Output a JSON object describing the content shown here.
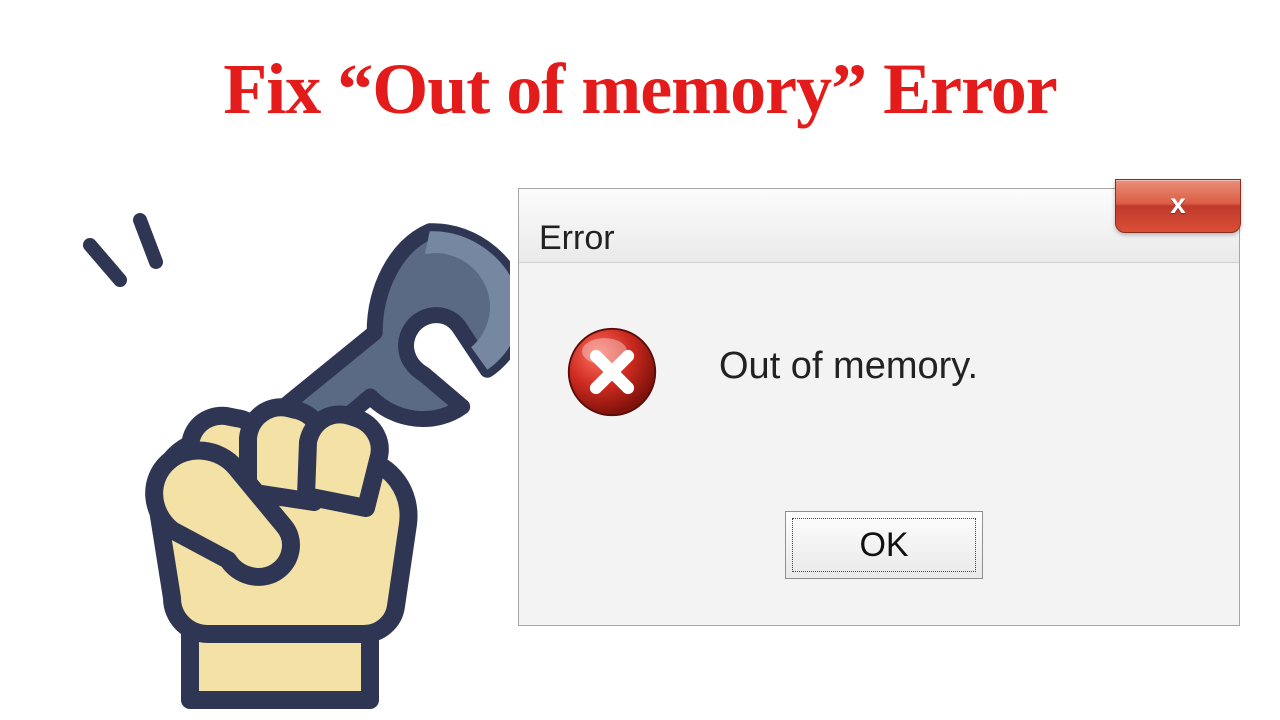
{
  "headline": "Fix “Out of memory” Error",
  "dialog": {
    "title": "Error",
    "message": "Out of memory.",
    "ok_label": "OK",
    "close_glyph": "x"
  }
}
